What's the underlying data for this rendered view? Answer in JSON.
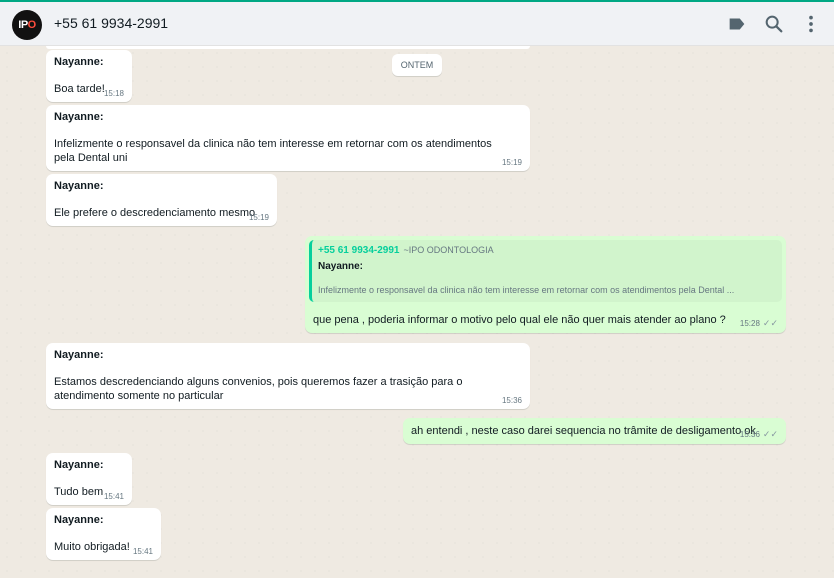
{
  "header": {
    "avatar_text_a": "IP",
    "avatar_text_b": "O",
    "contact": "+55 61 9934-2991",
    "icons": [
      "label-icon",
      "search-icon",
      "menu-icon"
    ]
  },
  "chat": {
    "date_badge": "ONTEM",
    "messages": [
      {
        "author": "Nayanne:",
        "text": "Boa tarde!",
        "time": "15:18"
      },
      {
        "author": "Nayanne:",
        "text": "Infelizmente o responsavel da clinica não tem interesse em retornar com os atendimentos pela Dental uni",
        "time": "15:19"
      },
      {
        "author": "Nayanne:",
        "text": "Ele prefere o descredenciamento mesmo",
        "time": "15:19"
      },
      {
        "quote_sender": "+55 61 9934-2991",
        "quote_sub": "~IPO ODONTOLOGIA",
        "quote_author": "Nayanne:",
        "quote_text": "Infelizmente o responsavel da clinica não tem interesse em retornar com os atendimentos pela Dental ...",
        "text": "que pena , poderia informar o motivo pelo qual ele não quer mais atender ao plano ?",
        "time": "15:28"
      },
      {
        "author": "Nayanne:",
        "text": "Estamos descredenciando alguns convenios, pois queremos fazer a trasição para o atendimento somente no particular",
        "time": "15:36"
      },
      {
        "text": "ah entendi , neste caso darei sequencia no trâmite de desligamento ok",
        "time": "15:36"
      },
      {
        "author": "Nayanne:",
        "text": "Tudo bem",
        "time": "15:41"
      },
      {
        "author": "Nayanne:",
        "text": "Muito obrigada!",
        "time": "15:41"
      }
    ]
  },
  "colors": {
    "accent": "#00a884",
    "incoming": "#ffffff",
    "outgoing": "#d9fdd3",
    "background": "#efeae2"
  }
}
